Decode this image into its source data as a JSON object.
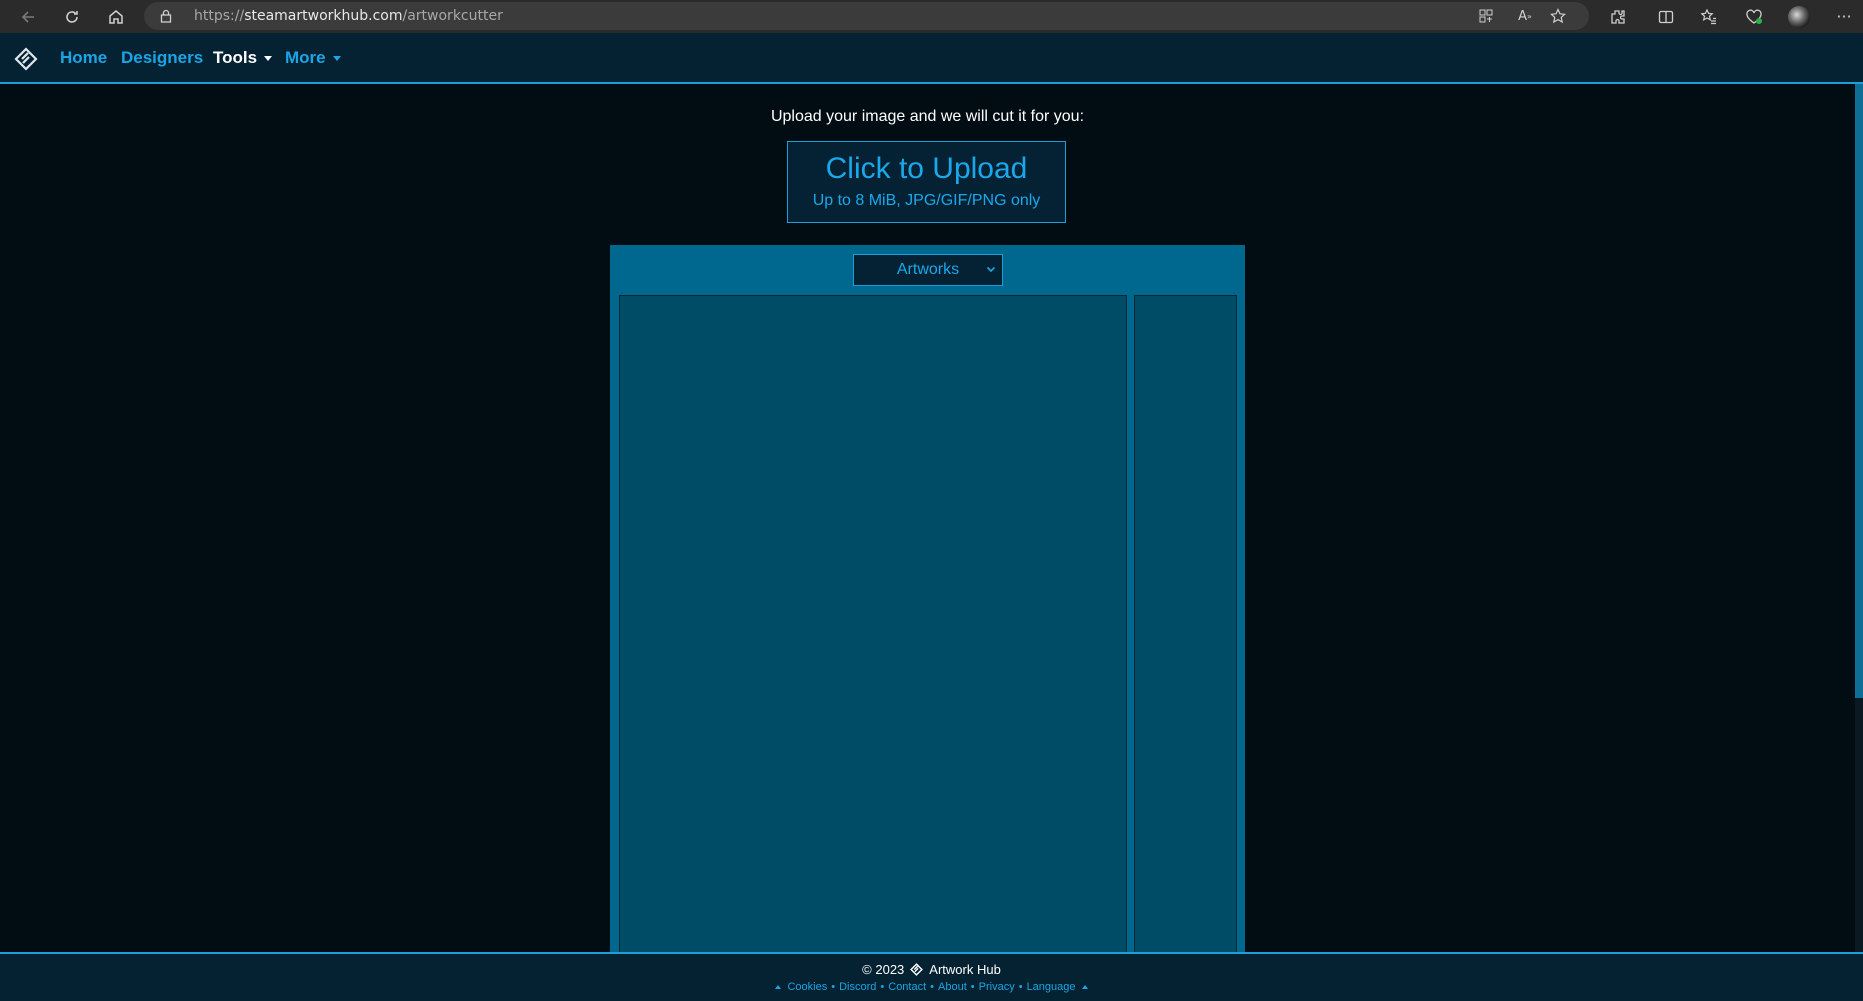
{
  "browser": {
    "url_scheme": "https://",
    "url_host": "steamartworkhub.com",
    "url_path": "/artworkcutter"
  },
  "nav": {
    "items": [
      {
        "label": "Home"
      },
      {
        "label": "Designers"
      },
      {
        "label": "Tools"
      },
      {
        "label": "More"
      }
    ]
  },
  "main": {
    "intro": "Upload your image and we will cut it for you:",
    "upload_title": "Click to Upload",
    "upload_subtitle": "Up to 8 MiB, JPG/GIF/PNG only",
    "select_value": "Artworks"
  },
  "footer": {
    "copyright": "© 2023",
    "brand": "Artwork Hub",
    "links": [
      "Cookies",
      "Discord",
      "Contact",
      "About",
      "Privacy",
      "Language"
    ]
  },
  "colors": {
    "accent": "#1ba5e6",
    "background": "#020c13",
    "panel": "#00688f",
    "preview": "#004c66"
  }
}
